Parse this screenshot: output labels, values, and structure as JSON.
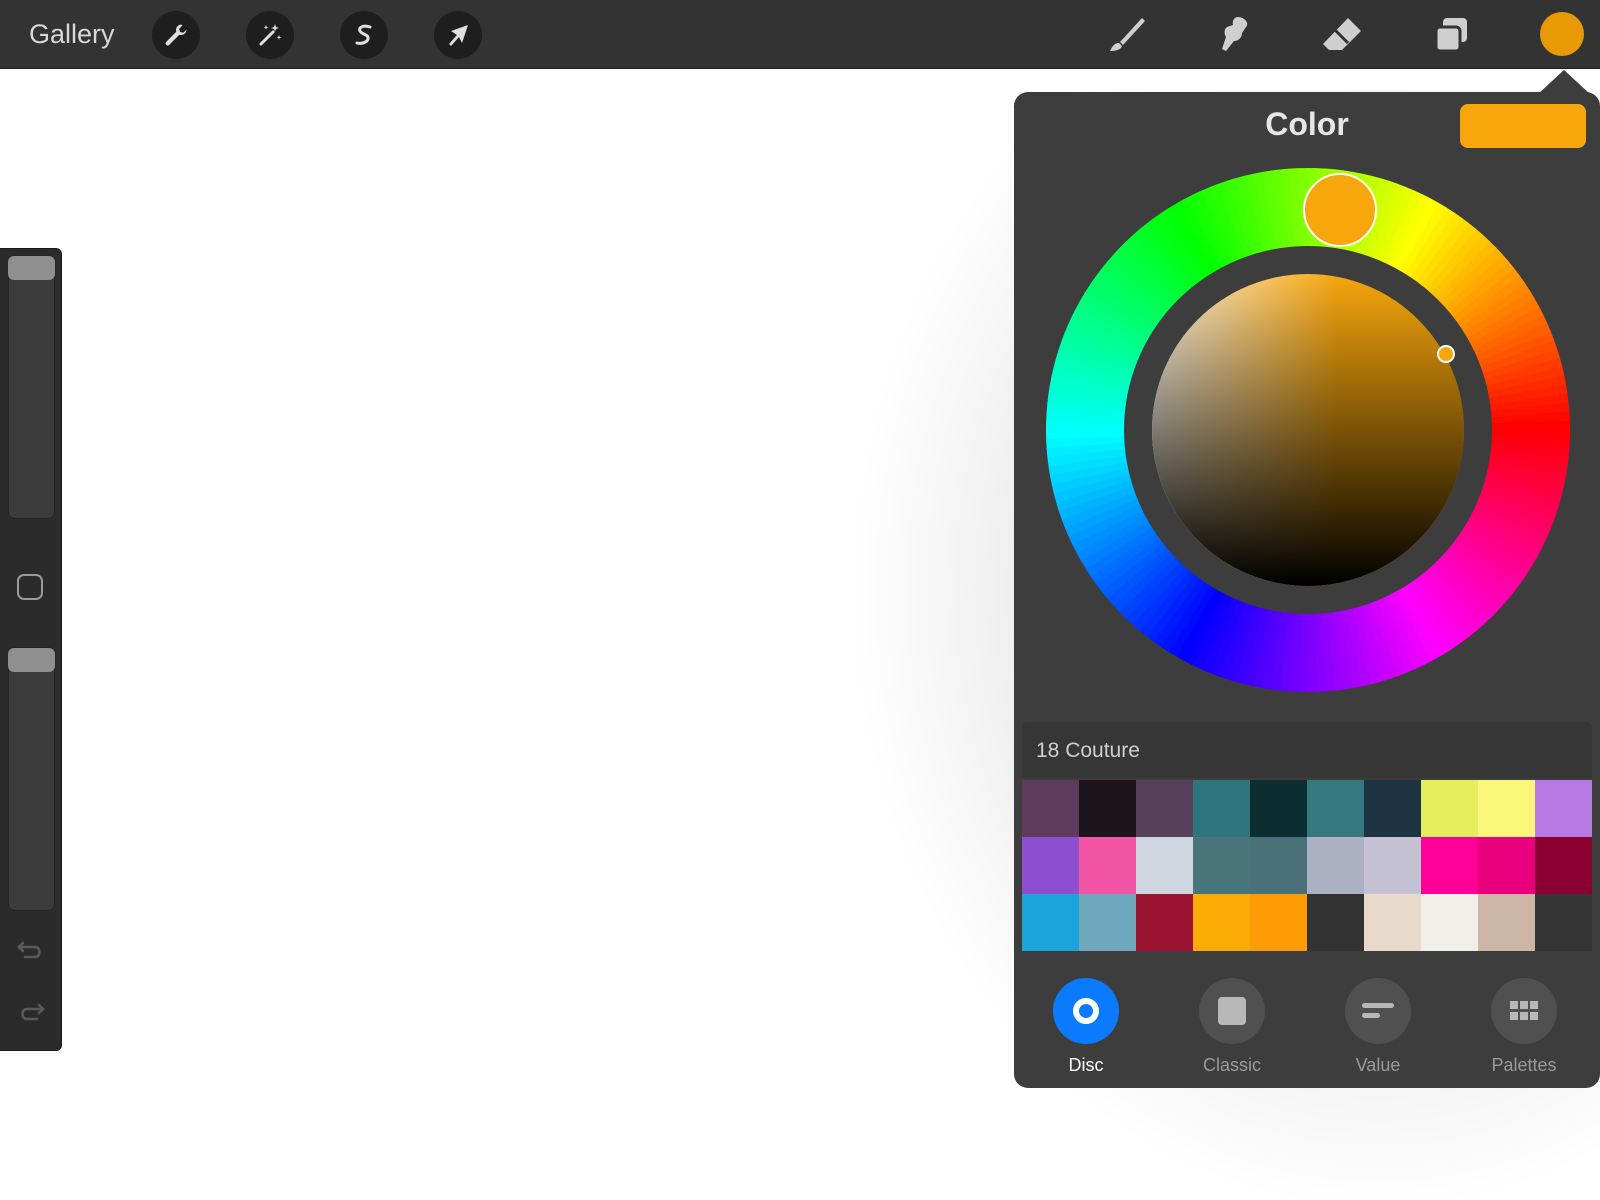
{
  "toolbar": {
    "gallery_label": "Gallery",
    "left_tools": [
      {
        "name": "actions",
        "icon": "wrench-icon"
      },
      {
        "name": "adjustments",
        "icon": "magic-wand-icon"
      },
      {
        "name": "selection",
        "icon": "selection-s-icon"
      },
      {
        "name": "transform",
        "icon": "arrow-cursor-icon"
      }
    ],
    "right_tools": [
      {
        "name": "brush",
        "icon": "brush-icon"
      },
      {
        "name": "smudge",
        "icon": "smudge-icon"
      },
      {
        "name": "eraser",
        "icon": "eraser-icon"
      },
      {
        "name": "layers",
        "icon": "layers-icon"
      }
    ],
    "current_color": "#E89A05"
  },
  "sidebar": {
    "brush_size_level": 1.0,
    "opacity_level": 1.0
  },
  "color_panel": {
    "title": "Color",
    "current_color": "#F7A60C",
    "palette": {
      "name": "18 Couture",
      "swatches": [
        "#5E3A5C",
        "#1B151B",
        "#56405A",
        "#2E747C",
        "#0C2E30",
        "#36787F",
        "#1C3442",
        "#E6EE5E",
        "#FAF77A",
        "#B779E3",
        "#8C4FCF",
        "#F255A6",
        "#CFD6DF",
        "#487579",
        "#4A7179",
        "#ACB0C3",
        "#C6C2D6",
        "#FF0098",
        "#E8007E",
        "#8A0030",
        "#1AA4DB",
        "#6FA8BC",
        "#9A1330",
        "#FBAD06",
        "#FD9C06",
        "#333333",
        "#E8DACB",
        "#F2EEEA",
        "#CDB6A6",
        "#353535"
      ]
    },
    "modes": [
      {
        "label": "Disc",
        "icon": "disc-icon",
        "active": true
      },
      {
        "label": "Classic",
        "icon": "square-icon",
        "active": false
      },
      {
        "label": "Value",
        "icon": "sliders-icon",
        "active": false
      },
      {
        "label": "Palettes",
        "icon": "grid-icon",
        "active": false
      }
    ]
  }
}
